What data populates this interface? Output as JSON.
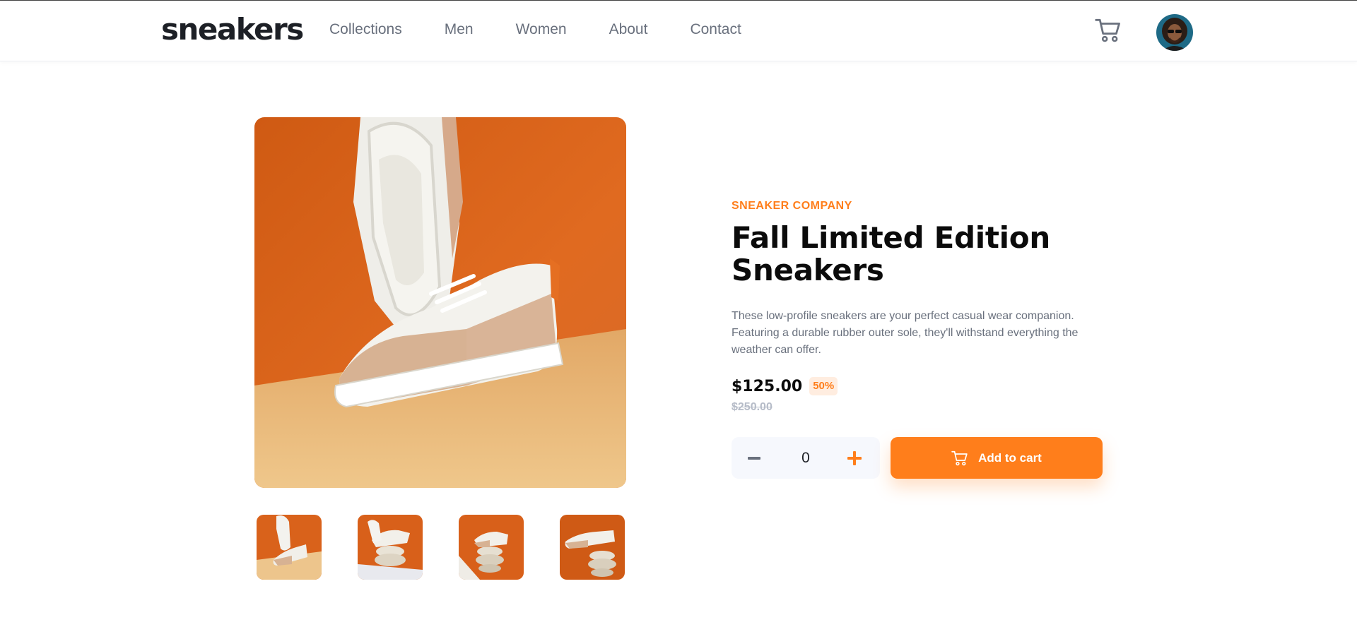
{
  "header": {
    "logo": "sneakers",
    "nav": [
      "Collections",
      "Men",
      "Women",
      "About",
      "Contact"
    ],
    "cart_icon": "cart-icon",
    "avatar_icon": "user-avatar"
  },
  "gallery": {
    "selected_index": 0,
    "thumbnail_count": 4
  },
  "product": {
    "company": "SNEAKER COMPANY",
    "title": "Fall Limited Edition Sneakers",
    "description": "These low-profile sneakers are your perfect casual wear companion. Featuring a durable rubber outer sole, they'll withstand everything the weather can offer.",
    "price": "$125.00",
    "discount": "50%",
    "original_price": "$250.00"
  },
  "quantity": {
    "value": "0",
    "minus_icon": "minus-icon",
    "plus_icon": "plus-icon"
  },
  "actions": {
    "add_to_cart": "Add to cart",
    "add_icon": "cart-icon"
  },
  "colors": {
    "accent": "#ff7e1b",
    "accent_pale": "#ffede0",
    "text_dark": "#1d2026",
    "text_gray": "#69707d",
    "muted": "#b6bcc8",
    "qty_bg": "#f6f8fd"
  }
}
